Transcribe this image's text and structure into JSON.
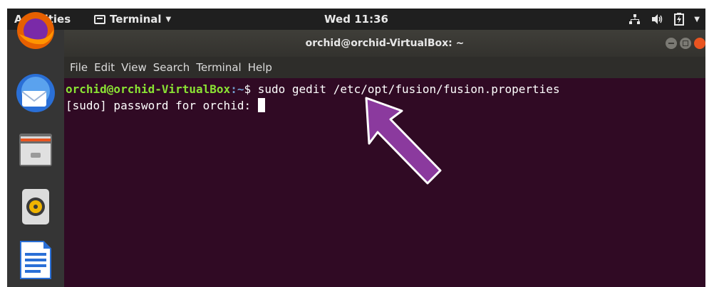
{
  "topbar": {
    "activities": "Activities",
    "app_menu": "Terminal",
    "clock": "Wed 11:36"
  },
  "dock": {
    "items": [
      "firefox",
      "thunderbird",
      "files",
      "rhythmbox",
      "libreoffice-writer"
    ]
  },
  "window": {
    "title": "orchid@orchid-VirtualBox: ~",
    "menu": [
      "File",
      "Edit",
      "View",
      "Search",
      "Terminal",
      "Help"
    ]
  },
  "terminal": {
    "line1": {
      "user_host": "orchid@orchid-VirtualBox",
      "path": ":~",
      "symbol": "$",
      "command": " sudo gedit /etc/opt/fusion/fusion.properties"
    },
    "line2": {
      "text": "[sudo] password for orchid: "
    }
  },
  "colors": {
    "terminal_bg": "#300a24",
    "prompt_user": "#8ae234",
    "prompt_path": "#729fcf",
    "annotation_arrow": "#8b3a9e"
  },
  "icons": {
    "app_menu": "terminal-icon",
    "status": [
      "network-icon",
      "volume-icon",
      "battery-icon",
      "system-menu-arrow-icon"
    ],
    "annotation": "arrow-pointer-icon"
  }
}
